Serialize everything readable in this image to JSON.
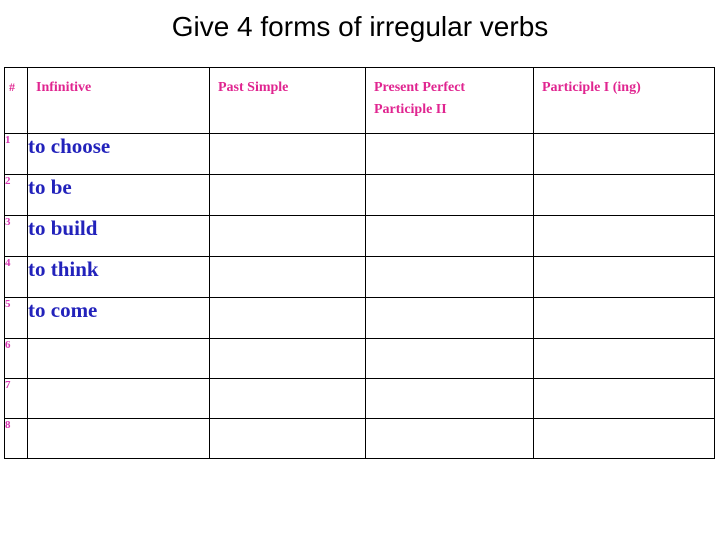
{
  "slide": {
    "title": "Give 4 forms of irregular verbs",
    "background_color": "#FFFFFF",
    "title_color": "#000000"
  },
  "colors": {
    "header_text": "#E02590",
    "row_number": "#D936B4",
    "verb_text": "#2222BB",
    "table_border": "#000000"
  },
  "table": {
    "headers": [
      {
        "label": "#",
        "name": "number"
      },
      {
        "label": "Infinitive",
        "name": "infinitive"
      },
      {
        "label": "Past Simple",
        "name": "past-simple"
      },
      {
        "label": "Present Perfect\nParticiple II",
        "name": "present-perfect-participle-ii"
      },
      {
        "label": "Participle I (ing)",
        "name": "participle-i-ing"
      }
    ],
    "rows": [
      {
        "num": "1",
        "infinitive": "to choose",
        "past_simple": "",
        "present_perfect": "",
        "participle_i": ""
      },
      {
        "num": "2",
        "infinitive": "to be",
        "past_simple": "",
        "present_perfect": "",
        "participle_i": ""
      },
      {
        "num": "3",
        "infinitive": "to build",
        "past_simple": "",
        "present_perfect": "",
        "participle_i": ""
      },
      {
        "num": "4",
        "infinitive": "to think",
        "past_simple": "",
        "present_perfect": "",
        "participle_i": ""
      },
      {
        "num": "5",
        "infinitive": "to come",
        "past_simple": "",
        "present_perfect": "",
        "participle_i": ""
      },
      {
        "num": "6",
        "infinitive": "",
        "past_simple": "",
        "present_perfect": "",
        "participle_i": ""
      },
      {
        "num": "7",
        "infinitive": "",
        "past_simple": "",
        "present_perfect": "",
        "participle_i": ""
      },
      {
        "num": "8",
        "infinitive": "",
        "past_simple": "",
        "present_perfect": "",
        "participle_i": ""
      }
    ]
  }
}
